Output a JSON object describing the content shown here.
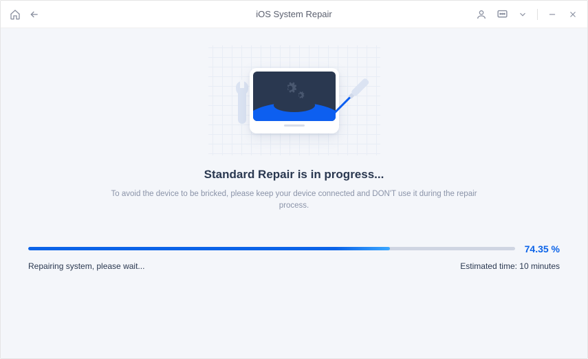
{
  "title": "iOS System Repair",
  "heading": "Standard Repair is in progress...",
  "subtext": "To avoid the device to be bricked, please keep your device connected and DON'T use it during the repair process.",
  "progress": {
    "percent": 74.35,
    "percent_label": "74.35 %",
    "status_text": "Repairing system, please wait...",
    "estimated_label": "Estimated time: 10 minutes"
  },
  "icons": {
    "home": "home-icon",
    "back": "back-arrow-icon",
    "user": "user-icon",
    "feedback": "feedback-icon",
    "dropdown": "chevron-down-icon",
    "minimize": "minimize-icon",
    "close": "close-icon"
  }
}
